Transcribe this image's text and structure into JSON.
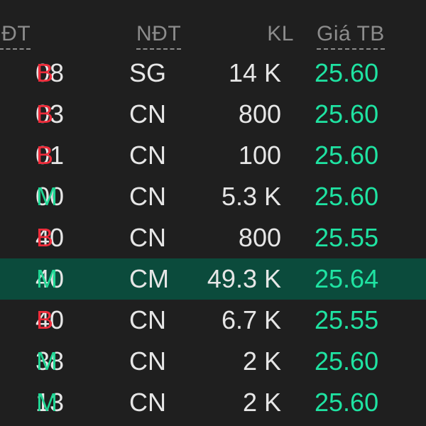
{
  "headers": {
    "time": "NĐT",
    "ndt": "NĐT",
    "kl": "KL",
    "gia": "Giá TB"
  },
  "colors": {
    "background": "#1f1f1f",
    "buy": "#ef2b3a",
    "match": "#1fd694",
    "price": "#1fe3a2",
    "highlight": "#0b4b3c"
  },
  "rows": [
    {
      "time": "08",
      "side": "B",
      "ndt": "SG",
      "kl": "14 K",
      "price": "25.60",
      "highlight": false
    },
    {
      "time": "03",
      "side": "B",
      "ndt": "CN",
      "kl": "800",
      "price": "25.60",
      "highlight": false
    },
    {
      "time": "01",
      "side": "B",
      "ndt": "CN",
      "kl": "100",
      "price": "25.60",
      "highlight": false
    },
    {
      "time": "00",
      "side": "M",
      "ndt": "CN",
      "kl": "5.3 K",
      "price": "25.60",
      "highlight": false
    },
    {
      "time": "40",
      "side": "B",
      "ndt": "CN",
      "kl": "800",
      "price": "25.55",
      "highlight": false
    },
    {
      "time": "40",
      "side": "M",
      "ndt": "CM",
      "kl": "49.3 K",
      "price": "25.64",
      "highlight": true
    },
    {
      "time": "40",
      "side": "B",
      "ndt": "CN",
      "kl": "6.7 K",
      "price": "25.55",
      "highlight": false
    },
    {
      "time": "38",
      "side": "M",
      "ndt": "CN",
      "kl": "2 K",
      "price": "25.60",
      "highlight": false
    },
    {
      "time": "13",
      "side": "M",
      "ndt": "CN",
      "kl": "2 K",
      "price": "25.60",
      "highlight": false
    }
  ]
}
